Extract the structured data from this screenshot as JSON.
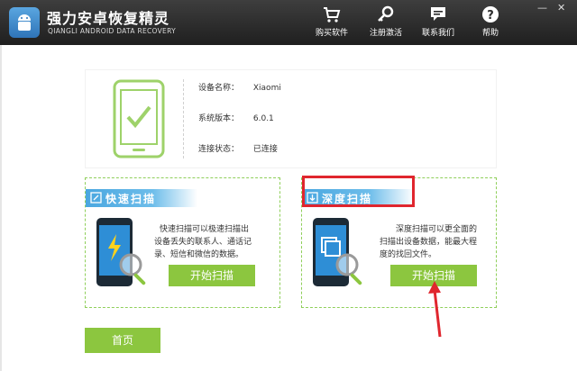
{
  "app": {
    "title": "强力安卓恢复精灵",
    "subtitle": "QIANGLI ANDROID DATA RECOVERY"
  },
  "toolbar": {
    "buy_label": "购买软件",
    "register_label": "注册激活",
    "contact_label": "联系我们",
    "help_label": "帮助"
  },
  "device": {
    "name_label": "设备名称：",
    "name_value": "Xiaomi",
    "version_label": "系统版本：",
    "version_value": "6.0.1",
    "status_label": "连接状态：",
    "status_value": "已连接"
  },
  "quick_scan": {
    "title": "快速扫描",
    "desc1": "快速扫描可以极速扫描出",
    "desc2": "设备丢失的联系人、通话记",
    "desc3": "录、短信和微信的数据。",
    "button": "开始扫描"
  },
  "deep_scan": {
    "title": "深度扫描",
    "desc1": "深度扫描可以更全面的",
    "desc2": "扫描出设备数据，能最大程",
    "desc3": "度的找回文件。",
    "button": "开始扫描"
  },
  "home_button": "首页",
  "colors": {
    "accent_green": "#8cc63f",
    "header_blue": "#4aa7e0",
    "highlight_red": "#e0262e"
  }
}
